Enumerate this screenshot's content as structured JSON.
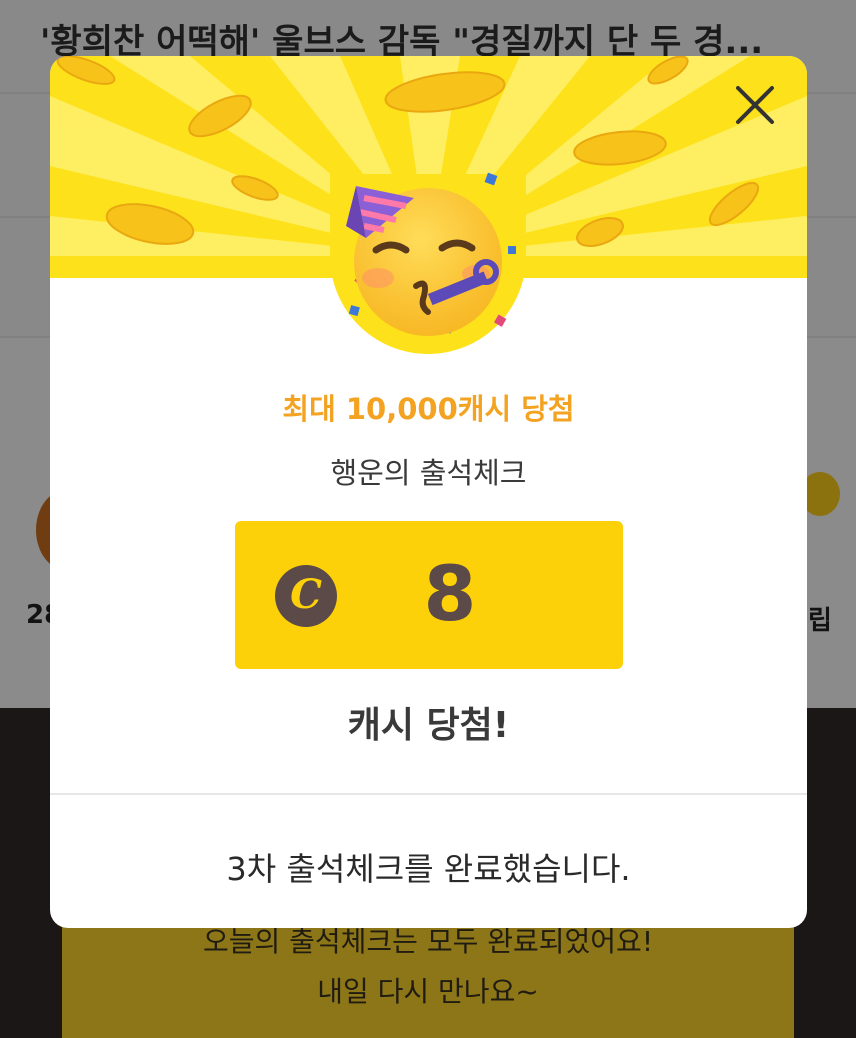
{
  "background": {
    "headline": "'황희찬 어떡해' 울브스 감독 \"경질까지 단 두 경...",
    "left_cut_text": "28",
    "right_cut_text": "립",
    "banner_line1": "오늘의 출석체크는 모두 완료되었어요!",
    "banner_line2": "내일 다시 만나요~"
  },
  "modal": {
    "close_icon": "close-icon",
    "emoji_icon": "partying-face-icon",
    "headline": "최대 10,000캐시 당첨",
    "subtitle": "행운의 출석체크",
    "coin_symbol": "C",
    "amount": "8",
    "win_text": "캐시 당첨!",
    "complete_text": "3차 출석체크를 완료했습니다."
  },
  "colors": {
    "accent_yellow": "#fde21b",
    "box_yellow": "#fdd10a",
    "headline_orange": "#f3a321",
    "coin_brown": "#5b4a47"
  }
}
